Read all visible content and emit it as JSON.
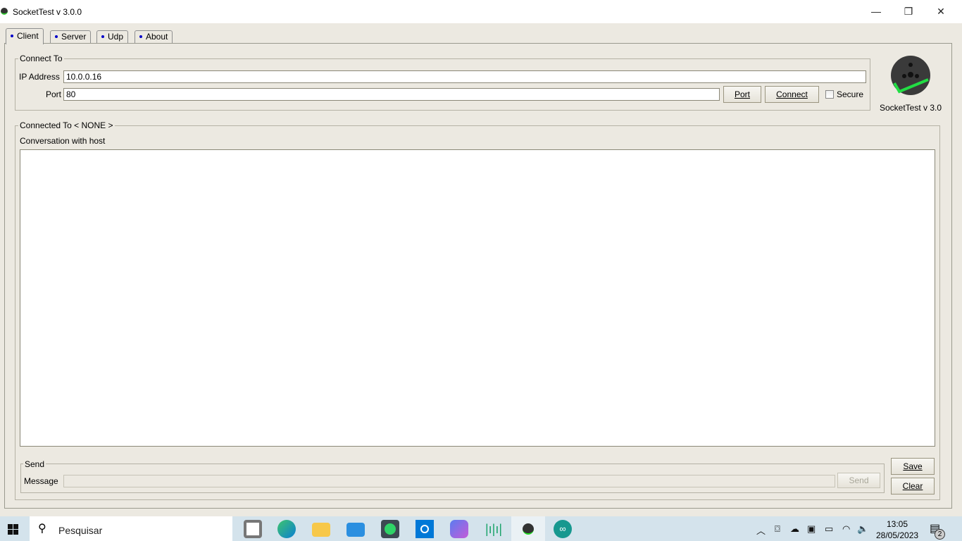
{
  "window": {
    "title": "SocketTest v 3.0.0",
    "minimize": "—",
    "maximize": "❐",
    "close": "✕"
  },
  "tabs": [
    {
      "label": "Client",
      "active": true
    },
    {
      "label": "Server"
    },
    {
      "label": "Udp"
    },
    {
      "label": "About"
    }
  ],
  "connect": {
    "legend": "Connect To",
    "ip_label": "IP Address",
    "ip_value": "10.0.0.16",
    "port_label": "Port",
    "port_value": "80",
    "port_button": "Port",
    "connect_button": "Connect",
    "secure_label": "Secure",
    "secure_checked": false
  },
  "logo": {
    "caption": "SocketTest v 3.0",
    "accent": "#22dd44"
  },
  "conversation": {
    "legend": "Connected To < NONE >",
    "label": "Conversation with host",
    "text": ""
  },
  "send": {
    "legend": "Send",
    "message_label": "Message",
    "message_value": "",
    "send_button": "Send",
    "save_button": "Save",
    "clear_button": "Clear"
  },
  "taskbar": {
    "search_placeholder": "Pesquisar",
    "time": "13:05",
    "date": "28/05/2023",
    "notifications": "2",
    "apps": [
      "app-icon",
      "edge-icon",
      "file-explorer-icon",
      "mail-icon",
      "whatsapp-icon",
      "cortana-icon",
      "microsoft365-icon",
      "audio-app-icon",
      "sockettest-icon",
      "arduino-icon"
    ]
  }
}
